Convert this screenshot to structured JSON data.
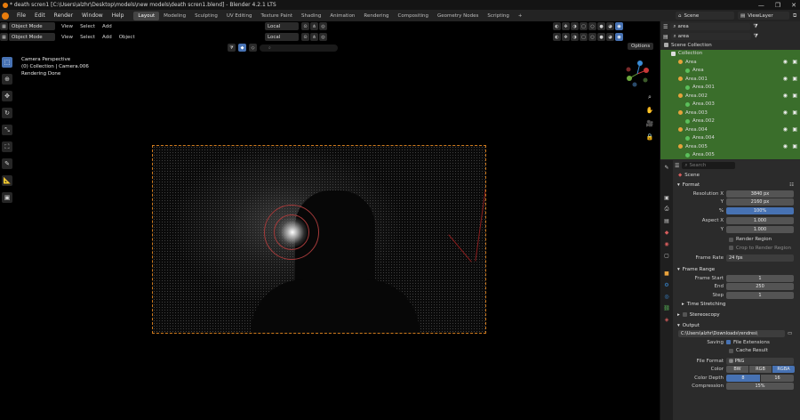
{
  "window": {
    "title": "* death scren1 [C:\\Users\\alzhr\\Desktop\\models\\new models\\death scren1.blend] - Blender 4.2.1 LTS",
    "controls": [
      "—",
      "❐",
      "✕"
    ]
  },
  "menubar": {
    "menus": [
      "File",
      "Edit",
      "Render",
      "Window",
      "Help"
    ],
    "workspaces": [
      "Layout",
      "Modeling",
      "Sculpting",
      "UV Editing",
      "Texture Paint",
      "Shading",
      "Animation",
      "Rendering",
      "Compositing",
      "Geometry Nodes",
      "Scripting"
    ],
    "active_workspace": "Layout",
    "add_tab": "+",
    "scene": "Scene",
    "view_layer": "ViewLayer"
  },
  "viewport": {
    "mode": "Object Mode",
    "menus": [
      "View",
      "Select",
      "Add",
      "Object"
    ],
    "transform_orientation": "Local",
    "options_label": "Options",
    "overlay_lines": [
      "Camera Perspective",
      "(0) Collection | Camera.006",
      "Rendering Done"
    ]
  },
  "outliner": {
    "search_value": "area",
    "rows": [
      {
        "label": "Scene Collection",
        "kind": "scene",
        "indent": 0
      },
      {
        "label": "Collection",
        "kind": "collection",
        "indent": 1
      },
      {
        "label": "Area",
        "kind": "light",
        "indent": 2
      },
      {
        "label": "Area",
        "kind": "data",
        "indent": 3
      },
      {
        "label": "Area.001",
        "kind": "light",
        "indent": 2
      },
      {
        "label": "Area.001",
        "kind": "data",
        "indent": 3
      },
      {
        "label": "Area.002",
        "kind": "light",
        "indent": 2
      },
      {
        "label": "Area.003",
        "kind": "data",
        "indent": 3
      },
      {
        "label": "Area.003",
        "kind": "light",
        "indent": 2
      },
      {
        "label": "Area.002",
        "kind": "data",
        "indent": 3
      },
      {
        "label": "Area.004",
        "kind": "light",
        "indent": 2
      },
      {
        "label": "Area.004",
        "kind": "data",
        "indent": 3
      },
      {
        "label": "Area.005",
        "kind": "light",
        "indent": 2
      },
      {
        "label": "Area.005",
        "kind": "data",
        "indent": 3
      }
    ]
  },
  "properties": {
    "search_placeholder": "Search",
    "context": "Scene",
    "format": {
      "title": "Format",
      "resolution_x_label": "Resolution X",
      "resolution_x": "3840 px",
      "resolution_y_label": "Y",
      "resolution_y": "2160 px",
      "percent_label": "%",
      "percent": "100%",
      "aspect_x_label": "Aspect X",
      "aspect_x": "1.000",
      "aspect_y_label": "Y",
      "aspect_y": "1.000",
      "render_region": "Render Region",
      "crop_region": "Crop to Render Region",
      "frame_rate_label": "Frame Rate",
      "frame_rate": "24 fps"
    },
    "frame_range": {
      "title": "Frame Range",
      "start_label": "Frame Start",
      "start": "1",
      "end_label": "End",
      "end": "250",
      "step_label": "Step",
      "step": "1"
    },
    "time_stretching": "Time Stretching",
    "stereoscopy": "Stereoscopy",
    "output": {
      "title": "Output",
      "path": "C:\\Users\\alzhr\\Downloads\\rendres\\",
      "saving_label": "Saving",
      "file_extensions": "File Extensions",
      "cache_result": "Cache Result",
      "file_format_label": "File Format",
      "file_format": "PNG",
      "color_label": "Color",
      "color_options": [
        "BW",
        "RGB",
        "RGBA"
      ],
      "color_selected": "RGBA",
      "depth_label": "Color Depth",
      "depth_options": [
        "8",
        "16"
      ],
      "depth_selected": "8",
      "compression_label": "Compression",
      "compression": "15%"
    }
  }
}
